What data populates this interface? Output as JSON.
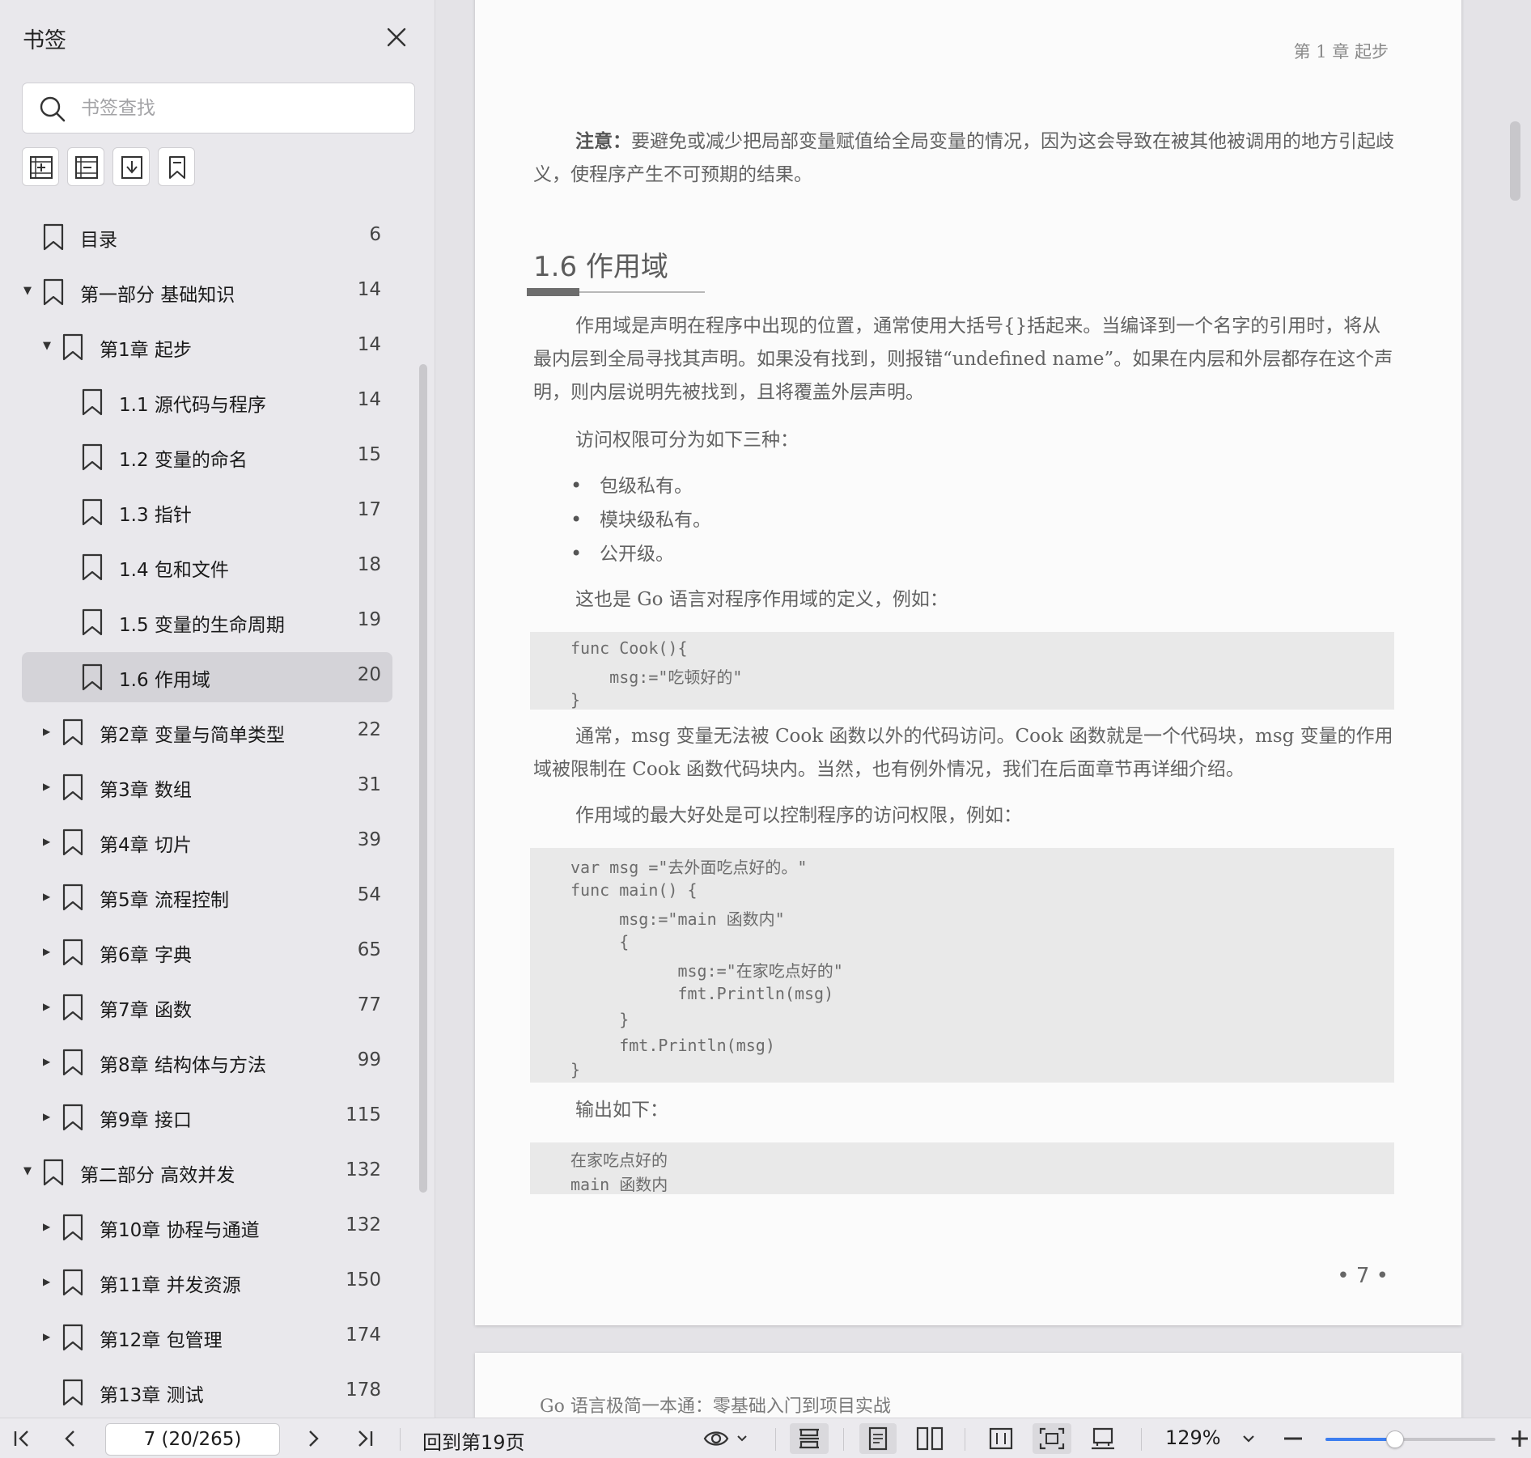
{
  "sidebar": {
    "title": "书签",
    "search_placeholder": "书签查找",
    "tools": [
      "add-bookmark-icon",
      "outline-icon",
      "bookmark-expand-icon",
      "bookmark-icon"
    ],
    "items": [
      {
        "label": "目录",
        "page": "6",
        "level": 0,
        "arrow": "none"
      },
      {
        "label": "第一部分  基础知识",
        "page": "14",
        "level": 0,
        "arrow": "down"
      },
      {
        "label": "第1章  起步",
        "page": "14",
        "level": 1,
        "arrow": "down"
      },
      {
        "label": "1.1  源代码与程序",
        "page": "14",
        "level": 2,
        "arrow": "none"
      },
      {
        "label": "1.2  变量的命名",
        "page": "15",
        "level": 2,
        "arrow": "none"
      },
      {
        "label": "1.3  指针",
        "page": "17",
        "level": 2,
        "arrow": "none"
      },
      {
        "label": "1.4  包和文件",
        "page": "18",
        "level": 2,
        "arrow": "none"
      },
      {
        "label": "1.5  变量的生命周期",
        "page": "19",
        "level": 2,
        "arrow": "none"
      },
      {
        "label": "1.6  作用域",
        "page": "20",
        "level": 2,
        "arrow": "none",
        "selected": true
      },
      {
        "label": "第2章  变量与简单类型",
        "page": "22",
        "level": 1,
        "arrow": "right"
      },
      {
        "label": "第3章  数组",
        "page": "31",
        "level": 1,
        "arrow": "right"
      },
      {
        "label": "第4章  切片",
        "page": "39",
        "level": 1,
        "arrow": "right"
      },
      {
        "label": "第5章  流程控制",
        "page": "54",
        "level": 1,
        "arrow": "right"
      },
      {
        "label": "第6章  字典",
        "page": "65",
        "level": 1,
        "arrow": "right"
      },
      {
        "label": "第7章  函数",
        "page": "77",
        "level": 1,
        "arrow": "right"
      },
      {
        "label": "第8章  结构体与方法",
        "page": "99",
        "level": 1,
        "arrow": "right"
      },
      {
        "label": "第9章  接口",
        "page": "115",
        "level": 1,
        "arrow": "right"
      },
      {
        "label": "第二部分  高效并发",
        "page": "132",
        "level": 0,
        "arrow": "down"
      },
      {
        "label": "第10章  协程与通道",
        "page": "132",
        "level": 1,
        "arrow": "right"
      },
      {
        "label": "第11章  并发资源",
        "page": "150",
        "level": 1,
        "arrow": "right"
      },
      {
        "label": "第12章  包管理",
        "page": "174",
        "level": 1,
        "arrow": "right"
      },
      {
        "label": "第13章  测试",
        "page": "178",
        "level": 1,
        "arrow": "none"
      }
    ]
  },
  "document": {
    "running_head": "第 1 章    起步",
    "note_label": "注意：",
    "note_text": "要避免或减少把局部变量赋值给全局变量的情况，因为这会导致在被其他被调用的地方引起歧义，使程序产生不可预期的结果。",
    "section_title": "1.6    作用域",
    "para1": "作用域是声明在程序中出现的位置，通常使用大括号{}括起来。当编译到一个名字的引用时，将从最内层到全局寻找其声明。如果没有找到，则报错“undefined name”。如果在内层和外层都存在这个声明，则内层说明先被找到，且将覆盖外层声明。",
    "para2": "访问权限可分为如下三种：",
    "bullets": [
      "包级私有。",
      "模块级私有。",
      "公开级。"
    ],
    "para3": "这也是 Go 语言对程序作用域的定义，例如：",
    "code1": [
      "func Cook(){",
      "    msg:=\"吃顿好的\"",
      "}"
    ],
    "para4": "通常，msg 变量无法被 Cook 函数以外的代码访问。Cook 函数就是一个代码块，msg 变量的作用域被限制在 Cook 函数代码块内。当然，也有例外情况，我们在后面章节再详细介绍。",
    "para5": "作用域的最大好处是可以控制程序的访问权限，例如：",
    "code2": [
      "var msg =\"去外面吃点好的。\"",
      "func main() {",
      "     msg:=\"main 函数内\"",
      "     {",
      "           msg:=\"在家吃点好的\"",
      "           fmt.Println(msg)",
      "     }",
      "     fmt.Println(msg)",
      "}"
    ],
    "para6": "输出如下：",
    "code3": [
      "在家吃点好的",
      "main 函数内"
    ],
    "page_number": "• 7 •",
    "next_page_header": "Go 语言极简一本通：零基础入门到项目实战"
  },
  "toolbar": {
    "page_value": "7 (20/265)",
    "back_label": "回到第19页",
    "zoom_label": "129%",
    "zoom_fraction": 0.41
  },
  "colors": {
    "accent": "#3d7ef0",
    "selected_row": "#d4d3d8"
  }
}
